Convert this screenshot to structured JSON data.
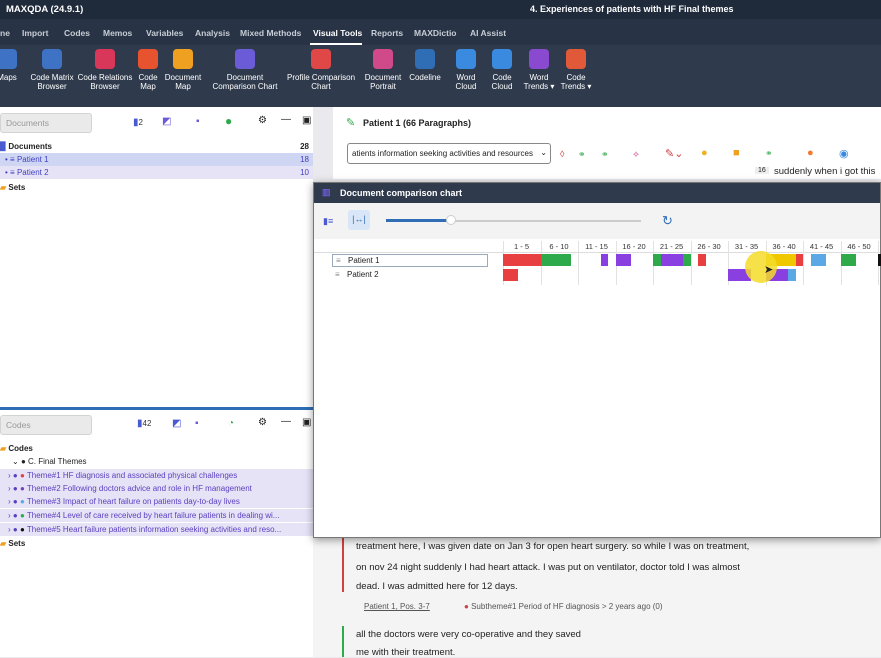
{
  "titlebar": {
    "app": "MAXQDA (24.9.1)",
    "document": "4. Experiences of patients with HF Final themes"
  },
  "menu": [
    "ne",
    "Import",
    "Codes",
    "Memos",
    "Variables",
    "Analysis",
    "Mixed Methods",
    "Visual Tools",
    "Reports",
    "MAXDictio",
    "AI Assist"
  ],
  "ribbon": [
    "Maps",
    "Code Matrix\nBrowser",
    "Code Relations\nBrowser",
    "Code\nMap",
    "Document\nMap",
    "Document\nComparison Chart",
    "Profile Comparison\nChart",
    "Document\nPortrait",
    "Codeline",
    "Word\nCloud",
    "Code\nCloud",
    "Word\nTrends ▾",
    "Code\nTrends ▾"
  ],
  "documents_pane": {
    "search_placeholder": "Documents",
    "count_badge": "2",
    "root": "Documents",
    "root_count": "28",
    "items": [
      {
        "label": "Patient 1",
        "count": "18"
      },
      {
        "label": "Patient 2",
        "count": "10"
      }
    ],
    "sets": "Sets"
  },
  "codes_pane": {
    "search_placeholder": "Codes",
    "count_badge": "42",
    "root": "Codes",
    "group": "C. Final Themes",
    "themes": [
      {
        "label": "Theme#1 HF diagnosis and associated physical challenges",
        "dot": "#e04040"
      },
      {
        "label": "Theme#2 Following doctors advice and role in HF management",
        "dot": "#7a3fbf"
      },
      {
        "label": "Theme#3 Impact of heart failure on patients day-to-day lives",
        "dot": "#5aa9e6"
      },
      {
        "label": "Theme#4 Level of care received  by heart failure patients in  dealing wi...",
        "dot": "#2eaa4a"
      },
      {
        "label": "Theme#5 Heart failure patients information seeking activities and reso...",
        "dot": "#111111"
      }
    ],
    "sets": "Sets",
    "right_num": "0"
  },
  "document_browser": {
    "title": "Patient 1",
    "paragraphs": "(66 Paragraphs)",
    "code_select": "atients information seeking activities and resources",
    "para_num": "16",
    "para_text": "suddenly when i got this"
  },
  "dialog": {
    "title": "Document comparison chart",
    "slider": 0.25,
    "columns": [
      "1 - 5",
      "6 - 10",
      "11 - 15",
      "16 - 20",
      "21 - 25",
      "26 - 30",
      "31 - 35",
      "36 - 40",
      "41 - 45",
      "46 - 50",
      "51 - 5"
    ],
    "rows": [
      "Patient 1",
      "Patient 2"
    ]
  },
  "segments": {
    "patient1": [
      {
        "start": 1,
        "end": 5,
        "color": "#e84040"
      },
      {
        "start": 6,
        "end": 9,
        "color": "#2eaa4a"
      },
      {
        "start": 14,
        "end": 14,
        "color": "#8a3fe0"
      },
      {
        "start": 16,
        "end": 17,
        "color": "#8a3fe0"
      },
      {
        "start": 21,
        "end": 21,
        "color": "#2eaa4a"
      },
      {
        "start": 22,
        "end": 24,
        "color": "#8a3fe0"
      },
      {
        "start": 25,
        "end": 25,
        "color": "#2eaa4a"
      },
      {
        "start": 27,
        "end": 27,
        "color": "#e84040"
      },
      {
        "start": 36,
        "end": 39,
        "color": "#f0c800"
      },
      {
        "start": 40,
        "end": 40,
        "color": "#e84040"
      },
      {
        "start": 42,
        "end": 43,
        "color": "#5aa9e6"
      },
      {
        "start": 46,
        "end": 47,
        "color": "#2eaa4a"
      },
      {
        "start": 51,
        "end": 51,
        "color": "#111111"
      }
    ],
    "patient2": [
      {
        "start": 1,
        "end": 2,
        "color": "#e84040"
      },
      {
        "start": 31,
        "end": 33,
        "color": "#8a3fe0"
      },
      {
        "start": 36,
        "end": 37,
        "color": "#8a3fe0"
      },
      {
        "start": 38,
        "end": 38,
        "color": "#8a3fe0"
      },
      {
        "start": 39,
        "end": 39,
        "color": "#5aa9e6"
      }
    ]
  },
  "text": {
    "l1": "treatment here, I was given date on Jan 3 for open heart surgery. so while I was on treatment,",
    "l2": "on nov 24 night suddenly I had heart attack. I was put on ventilator, doctor told I was almost",
    "l3": "dead. I was admitted here for 12 days.",
    "ref_link": "Patient 1, Pos. 3-7",
    "ref_code": "Subtheme#1 Period of HF diagnosis > 2 years ago (0)",
    "l4": "all the doctors were very co-operative and they saved",
    "l5": "me with their treatment."
  }
}
